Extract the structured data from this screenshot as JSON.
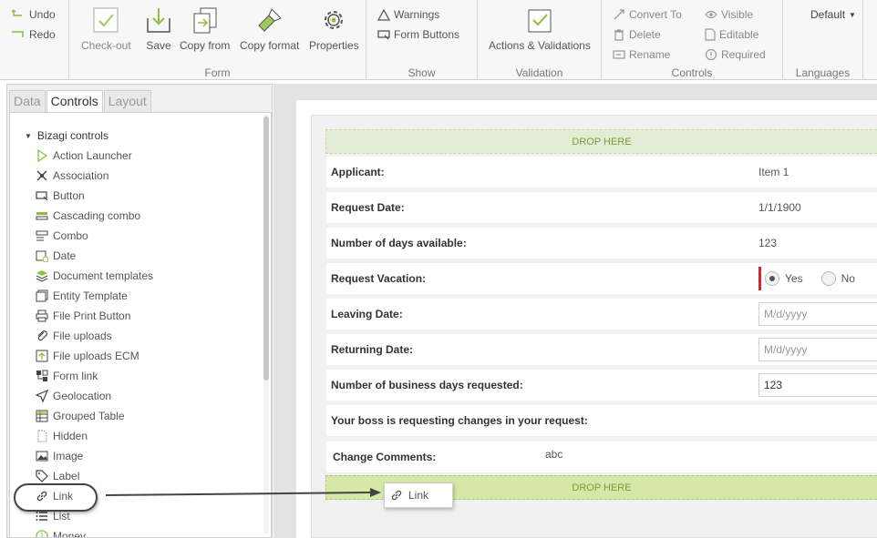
{
  "ribbon": {
    "undo": "Undo",
    "redo": "Redo",
    "form": {
      "label": "Form",
      "checkout": "Check-out",
      "save": "Save",
      "copy_from": "Copy from",
      "copy_format": "Copy format",
      "properties": "Properties"
    },
    "show": {
      "label": "Show",
      "warnings": "Warnings",
      "form_buttons": "Form Buttons"
    },
    "validation": {
      "label": "Validation",
      "actions_validations": "Actions & Validations"
    },
    "controls": {
      "label": "Controls",
      "convert_to": "Convert To",
      "delete": "Delete",
      "rename": "Rename",
      "visible": "Visible",
      "editable": "Editable",
      "required": "Required"
    },
    "languages": {
      "label": "Languages",
      "selected": "Default"
    }
  },
  "panel": {
    "tabs": [
      "Data",
      "Controls",
      "Layout"
    ],
    "active_tab": "Controls",
    "root": "Bizagi controls",
    "items": [
      {
        "label": "Action Launcher",
        "icon": "play-icon"
      },
      {
        "label": "Association",
        "icon": "association-icon"
      },
      {
        "label": "Button",
        "icon": "button-icon"
      },
      {
        "label": "Cascading combo",
        "icon": "cascading-combo-icon"
      },
      {
        "label": "Combo",
        "icon": "combo-icon"
      },
      {
        "label": "Date",
        "icon": "date-icon"
      },
      {
        "label": "Document templates",
        "icon": "document-templates-icon"
      },
      {
        "label": "Entity Template",
        "icon": "entity-template-icon"
      },
      {
        "label": "File Print Button",
        "icon": "print-icon"
      },
      {
        "label": "File uploads",
        "icon": "paperclip-icon"
      },
      {
        "label": "File uploads ECM",
        "icon": "upload-ecm-icon"
      },
      {
        "label": "Form link",
        "icon": "form-link-icon"
      },
      {
        "label": "Geolocation",
        "icon": "geolocation-icon"
      },
      {
        "label": "Grouped Table",
        "icon": "grouped-table-icon"
      },
      {
        "label": "Hidden",
        "icon": "hidden-icon"
      },
      {
        "label": "Image",
        "icon": "image-icon"
      },
      {
        "label": "Label",
        "icon": "label-icon"
      },
      {
        "label": "Link",
        "icon": "link-icon"
      },
      {
        "label": "List",
        "icon": "list-icon"
      },
      {
        "label": "Money",
        "icon": "money-icon"
      }
    ]
  },
  "form": {
    "drop_here": "DROP HERE",
    "rows": [
      {
        "label": "Applicant:",
        "kind": "text",
        "value": "Item 1"
      },
      {
        "label": "Request Date:",
        "kind": "text",
        "value": "1/1/1900"
      },
      {
        "label": "Number of days available:",
        "kind": "text",
        "value": "123"
      },
      {
        "label": "Request Vacation:",
        "kind": "radio",
        "options": [
          "Yes",
          "No"
        ],
        "selected": "Yes"
      },
      {
        "label": "Leaving Date:",
        "kind": "field",
        "placeholder": "M/d/yyyy"
      },
      {
        "label": "Returning Date:",
        "kind": "field",
        "placeholder": "M/d/yyyy"
      },
      {
        "label": "Number of business days requested:",
        "kind": "field",
        "value": "123"
      },
      {
        "label": "Your boss is requesting changes in your request:",
        "kind": "none"
      },
      {
        "label": "Change Comments:",
        "kind": "text",
        "value": "abc"
      }
    ]
  },
  "drag": {
    "label": "Link"
  },
  "colors": {
    "accent_green": "#8cbf3f",
    "drop_zone": "#e3ecd4",
    "drop_zone_active": "#d5e8a8",
    "required_marker": "#d9232e"
  }
}
